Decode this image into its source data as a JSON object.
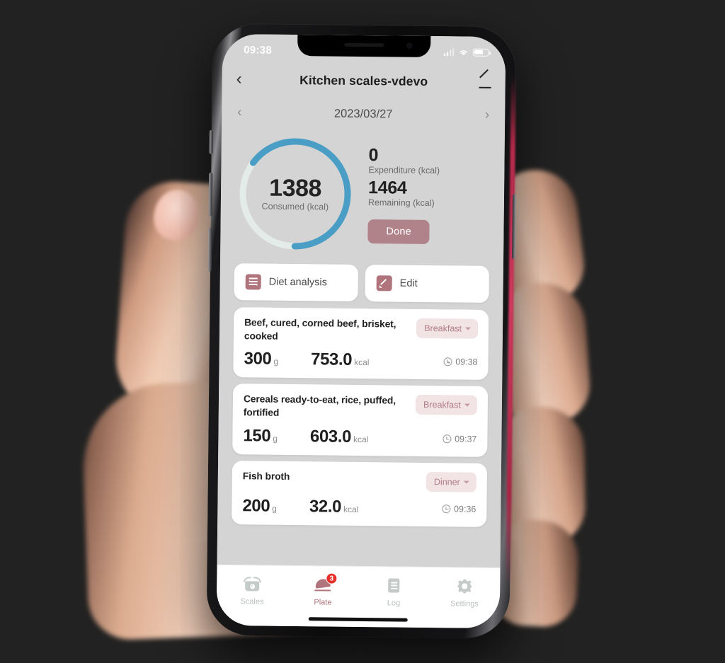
{
  "status_bar": {
    "time": "09:38",
    "signal_icon": "signal-bars-icon",
    "wifi_icon": "wifi-icon",
    "battery_icon": "battery-icon"
  },
  "nav": {
    "back_icon": "chevron-left-icon",
    "title": "Kitchen scales-vdevo",
    "edit_icon": "pencil-edit-icon"
  },
  "date_bar": {
    "prev_icon": "chevron-left-icon",
    "date": "2023/03/27",
    "next_icon": "chevron-right-icon"
  },
  "summary": {
    "ring": {
      "value": "1388",
      "label": "Consumed (kcal)",
      "percent": 65,
      "arc_color": "#4a9dc4",
      "track_color": "#e4ece9"
    },
    "expenditure_value": "0",
    "expenditure_label": "Expenditure (kcal)",
    "remaining_value": "1464",
    "remaining_label": "Remaining (kcal)",
    "done_label": "Done",
    "done_color": "#b0838a"
  },
  "actions": [
    {
      "label": "Diet analysis",
      "icon": "document-lines-icon"
    },
    {
      "label": "Edit",
      "icon": "pencil-square-icon"
    }
  ],
  "foods": [
    {
      "name": "Beef, cured, corned beef, brisket, cooked",
      "meal": "Breakfast",
      "amount": "300",
      "amount_unit": "g",
      "calories": "753.0",
      "calorie_unit": "kcal",
      "time": "09:38",
      "clock_icon": "clock-icon",
      "caret_icon": "caret-down-icon"
    },
    {
      "name": "Cereals ready-to-eat, rice, puffed, fortified",
      "meal": "Breakfast",
      "amount": "150",
      "amount_unit": "g",
      "calories": "603.0",
      "calorie_unit": "kcal",
      "time": "09:37",
      "clock_icon": "clock-icon",
      "caret_icon": "caret-down-icon"
    },
    {
      "name": "Fish broth",
      "meal": "Dinner",
      "amount": "200",
      "amount_unit": "g",
      "calories": "32.0",
      "calorie_unit": "kcal",
      "time": "09:36",
      "clock_icon": "clock-icon",
      "caret_icon": "caret-down-icon"
    }
  ],
  "tabs": [
    {
      "label": "Scales",
      "icon": "kitchen-scale-icon",
      "active": false,
      "badge": ""
    },
    {
      "label": "Plate",
      "icon": "food-cloche-icon",
      "active": true,
      "badge": "3"
    },
    {
      "label": "Log",
      "icon": "document-lines-icon",
      "active": false,
      "badge": ""
    },
    {
      "label": "Settings",
      "icon": "gear-icon",
      "active": false,
      "badge": ""
    }
  ],
  "theme": {
    "accent_rose": "#b0747d",
    "chip_bg": "#f2e3e5",
    "badge_red": "#e8302a",
    "screen_bg": "#d4d4d4",
    "backdrop": "#222222"
  }
}
